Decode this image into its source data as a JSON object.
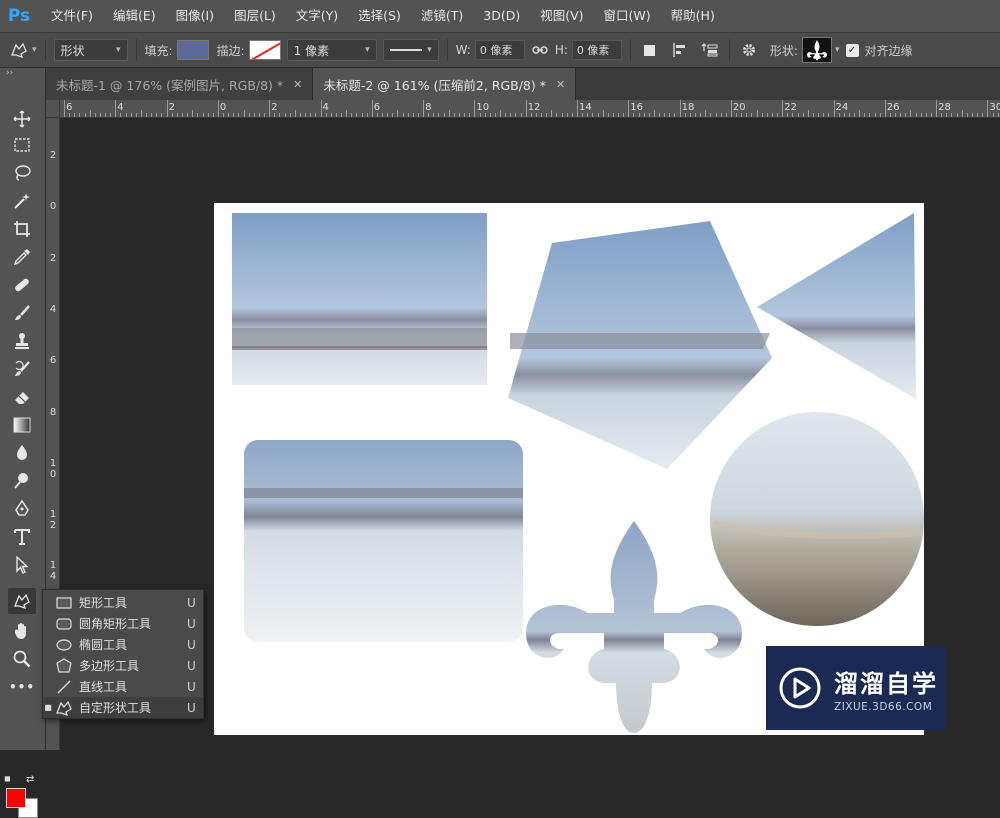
{
  "app": {
    "logo": "Ps"
  },
  "menu": [
    "文件(F)",
    "编辑(E)",
    "图像(I)",
    "图层(L)",
    "文字(Y)",
    "选择(S)",
    "滤镜(T)",
    "3D(D)",
    "视图(V)",
    "窗口(W)",
    "帮助(H)"
  ],
  "options": {
    "mode": "形状",
    "fill_label": "填充:",
    "fill_color": "#5e6b9a",
    "stroke_label": "描边:",
    "stroke_width": "1 像素",
    "w_label": "W:",
    "w_value": "0 像素",
    "h_label": "H:",
    "h_value": "0 像素",
    "shape_label": "形状:",
    "align_edges_label": "对齐边缘",
    "align_edges_checked": true
  },
  "tabs": [
    {
      "label": "未标题-1 @ 176% (案例图片, RGB/8) *",
      "active": false
    },
    {
      "label": "未标题-2 @ 161% (压缩前2, RGB/8) *",
      "active": true
    }
  ],
  "ruler_top": [
    "6",
    "4",
    "2",
    "0",
    "2",
    "4",
    "6",
    "8",
    "10",
    "12",
    "14",
    "16",
    "18",
    "20",
    "22",
    "24",
    "26",
    "28",
    "30"
  ],
  "ruler_left": [
    "2",
    "0",
    "2",
    "4",
    "6",
    "8",
    "1\n0",
    "1\n2",
    "1\n4"
  ],
  "flyout": [
    {
      "name": "矩形工具",
      "key": "U",
      "icon": "rectangle-icon",
      "selected": false
    },
    {
      "name": "圆角矩形工具",
      "key": "U",
      "icon": "rounded-rectangle-icon",
      "selected": false
    },
    {
      "name": "椭圆工具",
      "key": "U",
      "icon": "ellipse-icon",
      "selected": false
    },
    {
      "name": "多边形工具",
      "key": "U",
      "icon": "polygon-icon",
      "selected": false
    },
    {
      "name": "直线工具",
      "key": "U",
      "icon": "line-icon",
      "selected": false
    },
    {
      "name": "自定形状工具",
      "key": "U",
      "icon": "custom-shape-icon",
      "selected": true
    }
  ],
  "colors": {
    "foreground": "#ff0000",
    "background": "#ffffff"
  },
  "watermark": {
    "cn": "溜溜自学",
    "en": "ZIXUE.3D66.COM"
  }
}
